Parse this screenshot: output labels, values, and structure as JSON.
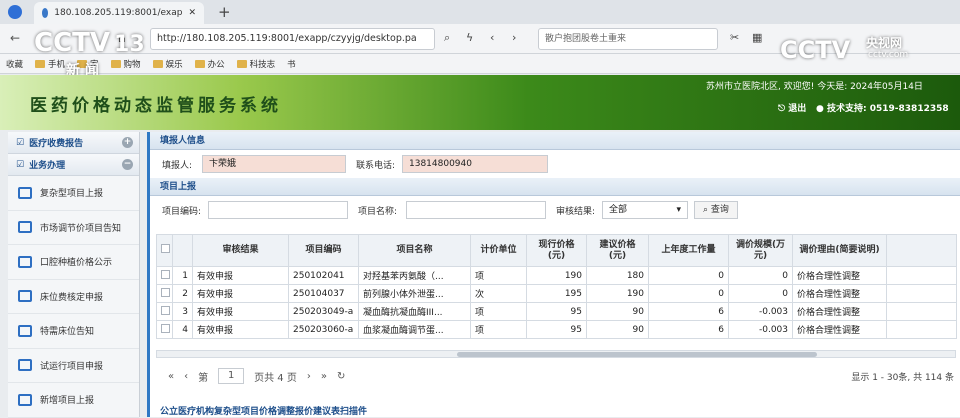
{
  "browser": {
    "tab_title": "180.108.205.119:8001/exap",
    "url": "http://180.108.205.119:8001/exapp/czyyjg/desktop.pa",
    "search_text": "散户抱团股卷土重来",
    "bookmarks": [
      "收藏",
      "手机",
      "家",
      "购物",
      "娱乐",
      "办公",
      "科技志",
      "书"
    ]
  },
  "overlay": {
    "cctv_left": "CCTV",
    "channel": "13",
    "news": "新 闻",
    "cctv_right": "CCTV",
    "site": "央视网",
    "site_domain": "cctv.com"
  },
  "header": {
    "system_title": "医药价格动态监管服务系统",
    "welcome": "苏州市立医院北区, 欢迎您! 今天是: 2024年05月14日",
    "logout": "退出",
    "support_label": "技术支持:",
    "support_phone": "0519-83812358"
  },
  "sidebar": {
    "sections": [
      {
        "label": "医疗收费报告"
      },
      {
        "label": "业务办理"
      }
    ],
    "items": [
      {
        "label": "复杂型项目上报"
      },
      {
        "label": "市场调节价项目告知"
      },
      {
        "label": "口腔种植价格公示"
      },
      {
        "label": "床位费核定申报"
      },
      {
        "label": "特需床位告知"
      },
      {
        "label": "试运行项目申报"
      },
      {
        "label": "新增项目上报"
      }
    ]
  },
  "filler": {
    "section_title": "填报人信息",
    "reporter_label": "填报人:",
    "reporter_value": "卞荣娥",
    "phone_label": "联系电话:",
    "phone_value": "13814800940"
  },
  "project": {
    "section_title": "项目上报",
    "code_label": "项目编码:",
    "name_label": "项目名称:",
    "review_label": "审核结果:",
    "review_value": "全部",
    "query_button": "查询"
  },
  "grid": {
    "columns": [
      "审核结果",
      "项目编码",
      "项目名称",
      "计价单位",
      "现行价格(元)",
      "建议价格(元)",
      "上年度工作量",
      "调价规模(万元)",
      "调价理由(简要说明)"
    ],
    "rows": [
      {
        "no": "1",
        "status": "有效申报",
        "code": "250102041",
        "name": "对羟基苯丙氨酸（...",
        "unit": "项",
        "current": "190",
        "suggested": "180",
        "workload": "0",
        "scale": "0",
        "reason": "价格合理性调整"
      },
      {
        "no": "2",
        "status": "有效申报",
        "code": "250104037",
        "name": "前列腺小体外泄蛋...",
        "unit": "次",
        "current": "195",
        "suggested": "190",
        "workload": "0",
        "scale": "0",
        "reason": "价格合理性调整"
      },
      {
        "no": "3",
        "status": "有效申报",
        "code": "250203049-a",
        "name": "凝血酶抗凝血酶III...",
        "unit": "项",
        "current": "95",
        "suggested": "90",
        "workload": "6",
        "scale": "-0.003",
        "reason": "价格合理性调整"
      },
      {
        "no": "4",
        "status": "有效申报",
        "code": "250203060-a",
        "name": "血浆凝血酶调节蛋...",
        "unit": "项",
        "current": "95",
        "suggested": "90",
        "workload": "6",
        "scale": "-0.003",
        "reason": "价格合理性调整"
      }
    ]
  },
  "pager": {
    "page_label": "第",
    "page_value": "1",
    "total_pages": "页共 4 页",
    "info": "显示 1 - 30条, 共 114 条"
  },
  "footer": {
    "title": "公立医疗机构复杂型项目价格调整报价建议表扫描件"
  }
}
